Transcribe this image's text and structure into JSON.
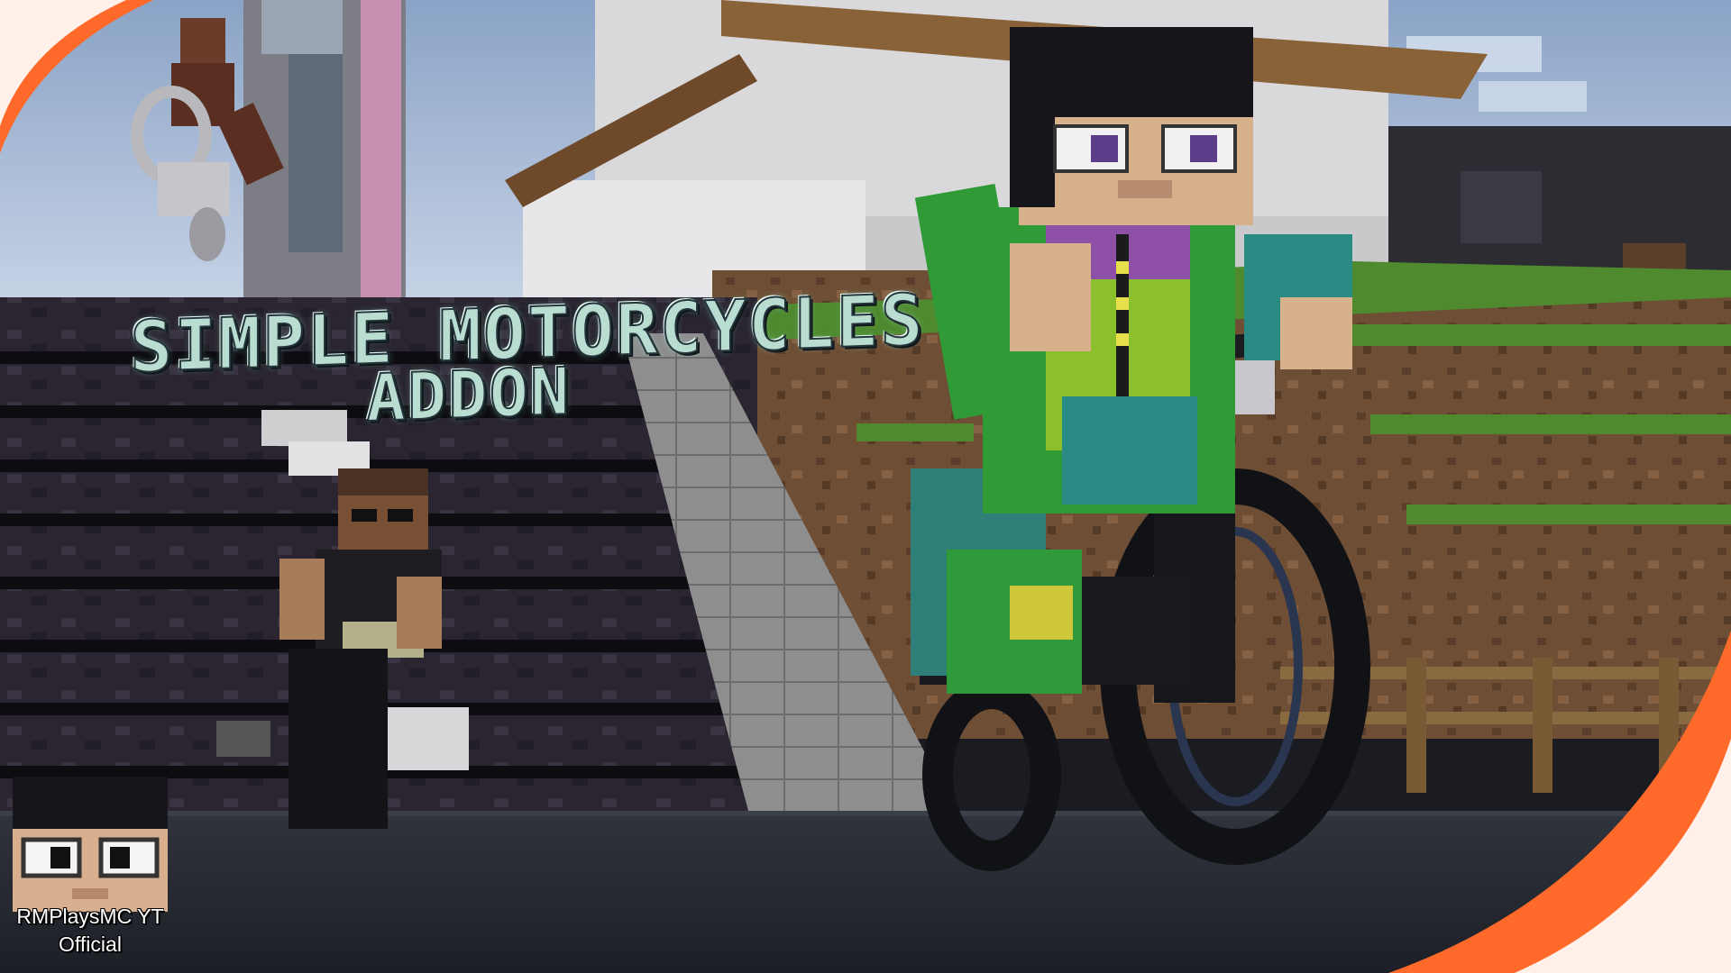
{
  "title": {
    "line1": "Simple Motorcycles",
    "line2": "Addon"
  },
  "channel": {
    "name_line1": "RMPlaysMC YT",
    "name_line2": "Official"
  },
  "accent_colors": {
    "corner_swoosh": "#ff6a2a",
    "title_fill": "#b9ddd0",
    "jacket_green": "#2f9a36"
  }
}
